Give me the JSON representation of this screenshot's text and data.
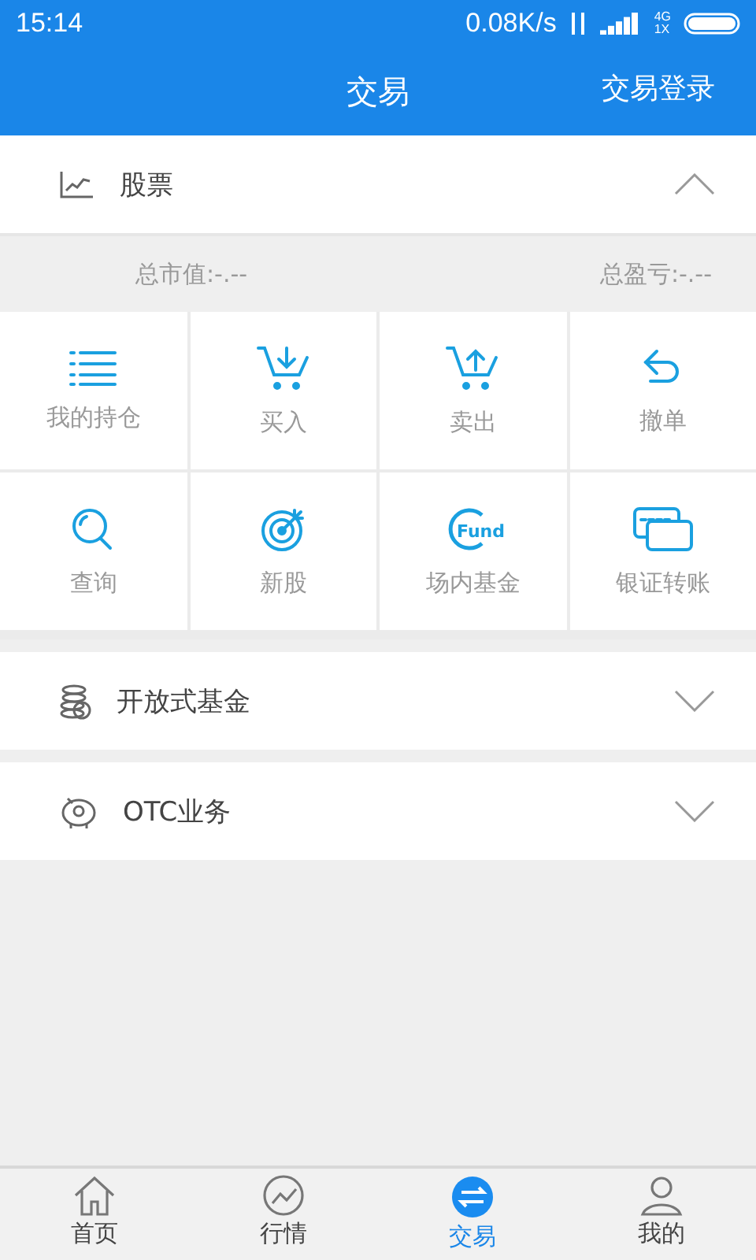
{
  "status_bar": {
    "time": "15:14",
    "speed": "0.08K/s",
    "network_top": "4G",
    "network_bottom": "1X"
  },
  "header": {
    "title": "交易",
    "action": "交易登录"
  },
  "sections": [
    {
      "label": "股票",
      "expanded": true,
      "summary": [
        {
          "text": "总市值:-.--"
        },
        {
          "text": "总盈亏:-.--"
        }
      ],
      "grid": [
        {
          "label": "我的持仓"
        },
        {
          "label": "买入"
        },
        {
          "label": "卖出"
        },
        {
          "label": "撤单"
        },
        {
          "label": "查询"
        },
        {
          "label": "新股"
        },
        {
          "label": "场内基金",
          "icon_text": "Fund"
        },
        {
          "label": "银证转账"
        }
      ]
    },
    {
      "label": "开放式基金",
      "expanded": false
    },
    {
      "label": "OTC业务",
      "expanded": false
    }
  ],
  "tab_bar": [
    {
      "label": "首页",
      "selected": false
    },
    {
      "label": "行情",
      "selected": false
    },
    {
      "label": "交易",
      "selected": true
    },
    {
      "label": "我的",
      "selected": false
    }
  ]
}
